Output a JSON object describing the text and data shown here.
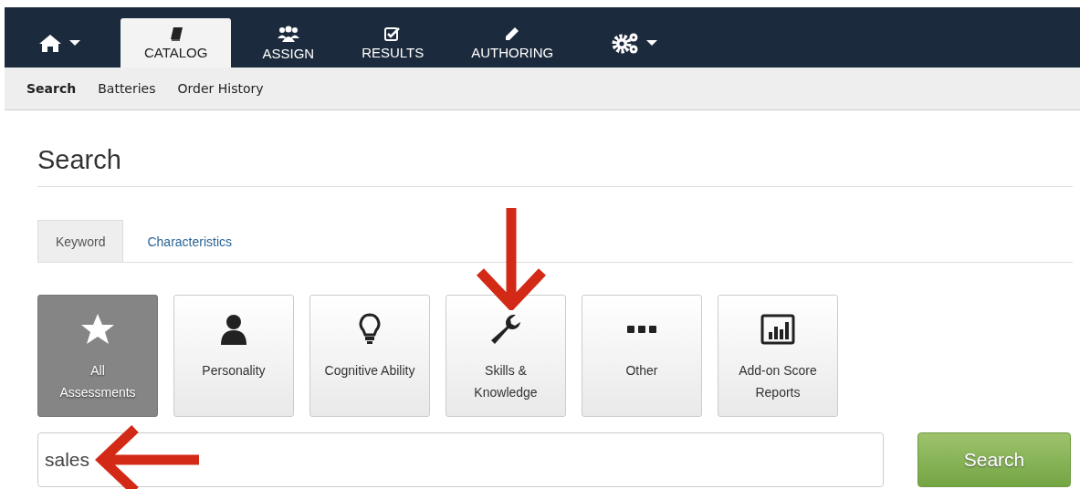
{
  "navbar": {
    "items": [
      {
        "kind": "home",
        "selected": false
      },
      {
        "kind": "tab",
        "label": "CATALOG",
        "selected": true
      },
      {
        "kind": "tab",
        "label": "ASSIGN",
        "selected": false
      },
      {
        "kind": "tab",
        "label": "RESULTS",
        "selected": false
      },
      {
        "kind": "tab",
        "label": "AUTHORING",
        "selected": false
      },
      {
        "kind": "settings",
        "selected": false
      }
    ]
  },
  "subnav": [
    {
      "label": "Search",
      "selected": true
    },
    {
      "label": "Batteries",
      "selected": false
    },
    {
      "label": "Order History",
      "selected": false
    }
  ],
  "heading": "Search",
  "tabs": [
    {
      "label": "Keyword",
      "selected": true
    },
    {
      "label": "Characteristics",
      "selected": false
    }
  ],
  "categories": [
    {
      "label": "All\nAssessments",
      "selected": true
    },
    {
      "label": "Personality",
      "selected": false
    },
    {
      "label": "Cognitive Ability",
      "selected": false
    },
    {
      "label": "Skills &\nKnowledge",
      "selected": false
    },
    {
      "label": "Other",
      "selected": false
    },
    {
      "label": "Add-on Score\nReports",
      "selected": false
    }
  ],
  "search_field": {
    "value": "sales"
  },
  "search_button": {
    "label": "Search"
  },
  "annotations": [
    {
      "kind": "down-arrow"
    },
    {
      "kind": "left-arrow"
    }
  ]
}
